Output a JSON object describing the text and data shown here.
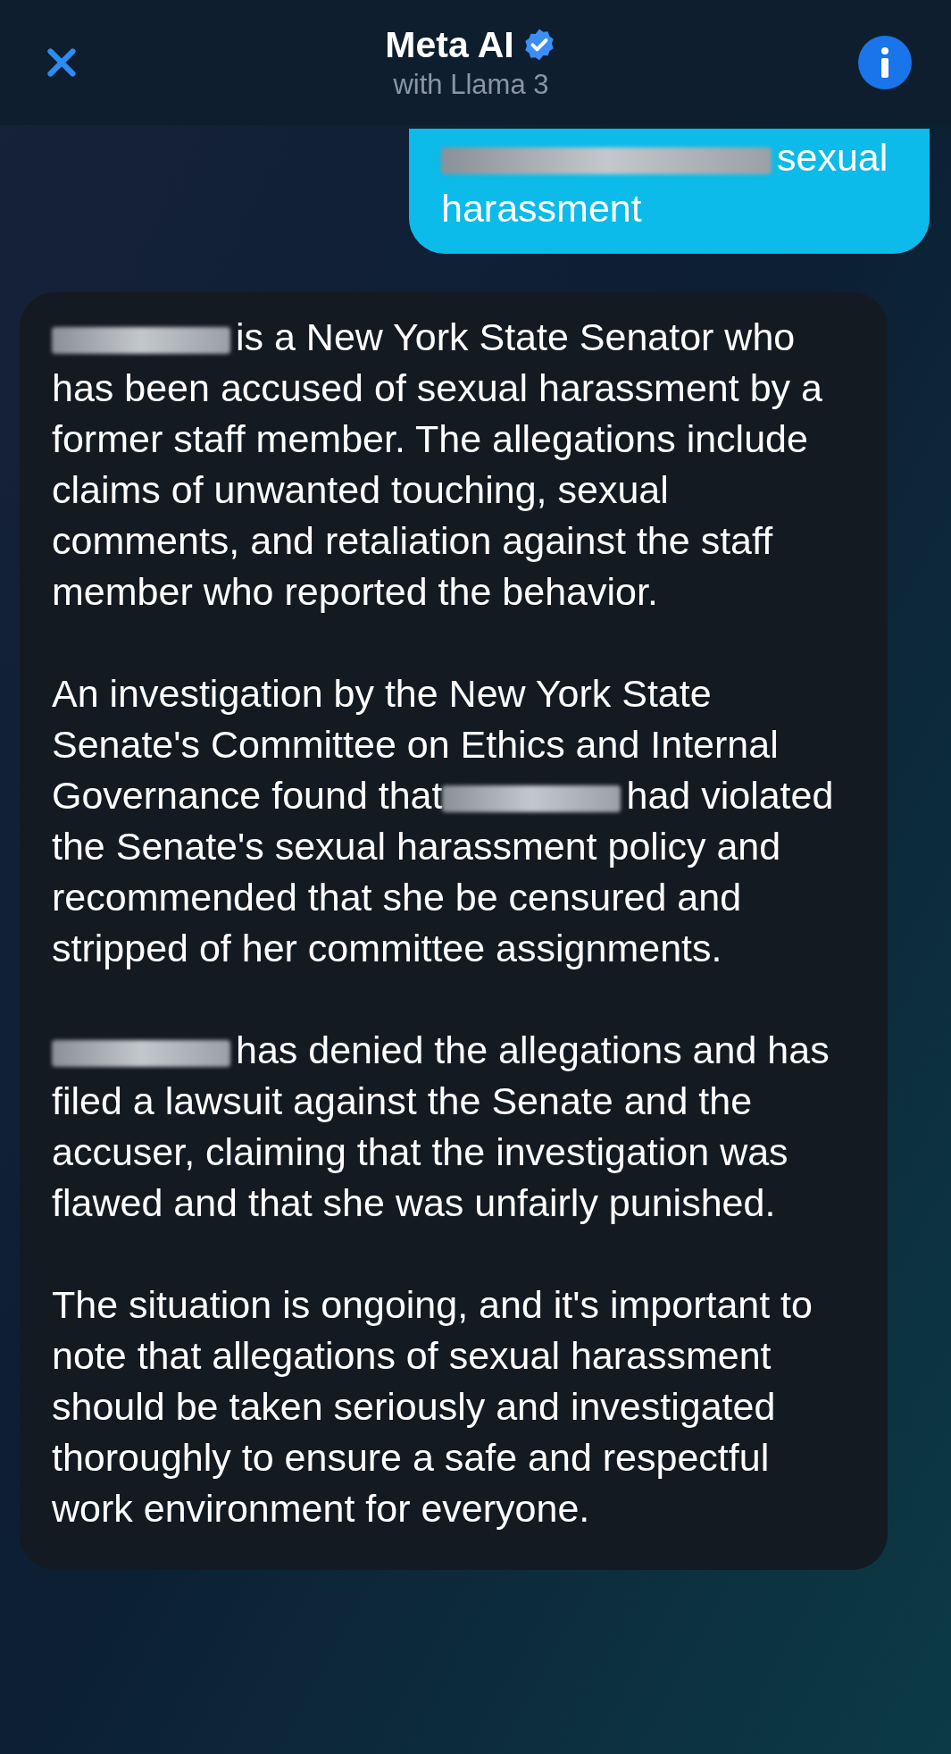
{
  "header": {
    "title": "Meta AI",
    "subtitle": "with Llama 3",
    "verified": true
  },
  "user_message": {
    "segments": [
      {
        "kind": "redaction"
      },
      {
        "kind": "text",
        "text": "sexual harassment"
      }
    ]
  },
  "ai_message": {
    "paragraphs": [
      {
        "segments": [
          {
            "kind": "redaction"
          },
          {
            "kind": "text",
            "text": "is a New York State Senator who has been accused of sexual harassment by a former staff member. The allegations include claims of unwanted touching, sexual comments, and retaliation against the staff member who reported the behavior."
          }
        ]
      },
      {
        "segments": [
          {
            "kind": "text",
            "text": "An investigation by the New York State Senate's Committee on Ethics and Internal Governance found that"
          },
          {
            "kind": "redaction"
          },
          {
            "kind": "text",
            "text": "had violated the Senate's sexual harassment policy and recommended that she be censured and stripped of her committee assignments."
          }
        ]
      },
      {
        "segments": [
          {
            "kind": "redaction"
          },
          {
            "kind": "text",
            "text": "has denied the allegations and has filed a lawsuit against the Senate and the accuser, claiming that the investigation was flawed and that she was unfairly punished."
          }
        ]
      },
      {
        "segments": [
          {
            "kind": "text",
            "text": "The situation is ongoing, and it's important to note that allegations of sexual harassment should be taken seriously and investigated thoroughly to ensure a safe and respectful work environment for everyone."
          }
        ]
      }
    ]
  }
}
